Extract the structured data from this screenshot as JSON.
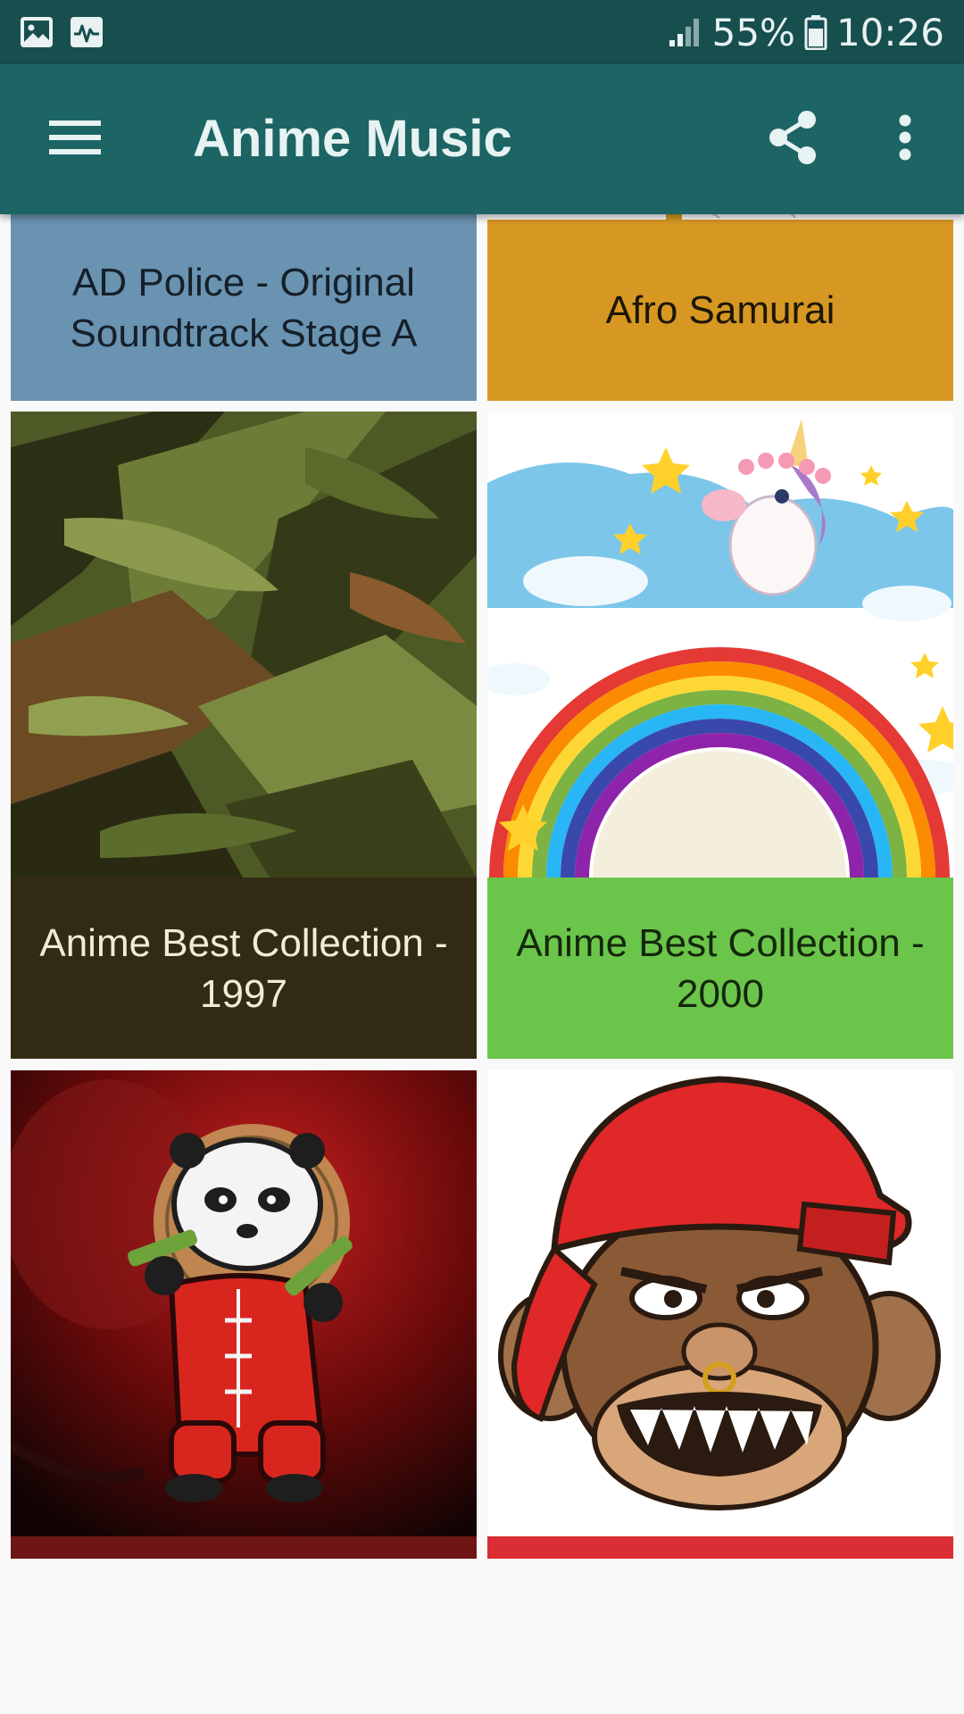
{
  "status_bar": {
    "icons": [
      "gallery-icon",
      "activity-monitor-icon",
      "signal-icon",
      "battery-icon"
    ],
    "battery": "55%",
    "time": "10:26"
  },
  "toolbar": {
    "title": "Anime Music",
    "icons": [
      "hamburger-menu-icon",
      "share-icon",
      "more-vert-icon"
    ]
  },
  "albums": [
    {
      "title": "AD Police - Original Soundtrack Stage A",
      "label_color": "#6a93b1",
      "text_color": "#15202a"
    },
    {
      "title": "Afro Samurai",
      "label_color": "#d69822",
      "text_color": "#1d1608"
    },
    {
      "title": "Anime Best Collection - 1997",
      "label_color": "#332a14",
      "text_color": "#f1ecd8",
      "artwork": "camouflage-brush-art"
    },
    {
      "title": "Anime Best Collection - 2000",
      "label_color": "#6cc54b",
      "text_color": "#13280b",
      "artwork": "unicorn-rainbow-art"
    },
    {
      "title": "",
      "label_color": "#6e1515",
      "artwork": "kung-fu-panda-mascot-art"
    },
    {
      "title": "",
      "label_color": "#d92f34",
      "artwork": "angry-monkey-red-cap-art"
    }
  ]
}
